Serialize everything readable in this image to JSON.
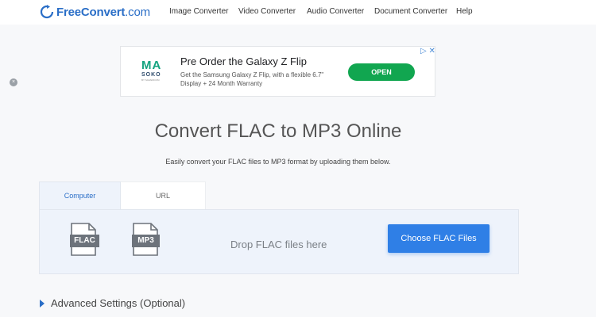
{
  "header": {
    "logo_text_bold": "FreeConvert",
    "logo_text_domain": ".com",
    "nav": [
      "Image Converter",
      "Video Converter",
      "Audio Converter",
      "Document Converter",
      "Help"
    ]
  },
  "ad": {
    "logo_line1": "MA",
    "logo_line2": "SOKO",
    "logo_line3": "BY SAFARICOM",
    "title": "Pre Order the Galaxy Z Flip",
    "description": "Get the Samsung Galaxy Z Flip, with a flexible 6.7\" Display + 24 Month Warranty",
    "cta": "OPEN",
    "choices_icons": "▷ ✕"
  },
  "side_close_glyph": "×",
  "main": {
    "title": "Convert FLAC to MP3 Online",
    "subtitle": "Easily convert your FLAC files to MP3 format by uploading them below.",
    "tabs": [
      "Computer",
      "URL"
    ],
    "source_format": "FLAC",
    "target_format": "MP3",
    "arrow": "→",
    "drop_text": "Drop FLAC files here",
    "choose_button": "Choose FLAC Files",
    "advanced_settings": "Advanced Settings (Optional)"
  },
  "colors": {
    "brand_blue": "#2a6ec7",
    "button_blue": "#2f7fe6",
    "ad_green": "#11a650"
  }
}
